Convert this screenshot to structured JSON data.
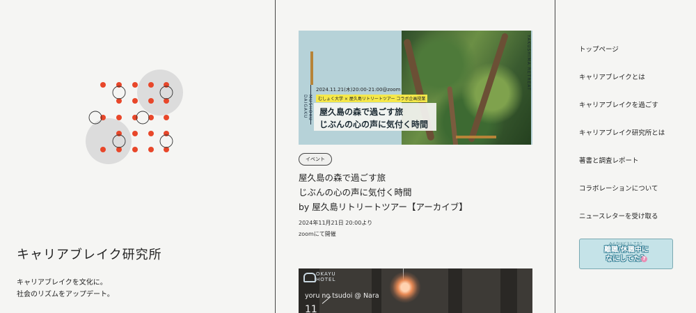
{
  "site": {
    "title": "キャリアブレイク研究所",
    "tagline_line1": "キャリアブレイクを文化に。",
    "tagline_line2": "社会のリズムをアップデート。"
  },
  "colors": {
    "accent": "#e8472a",
    "circle_fill": "#dcdcdc",
    "background": "#f5f5f3"
  },
  "card1": {
    "image": {
      "date": "2024.11.21(木)20:00-21:00@zoom",
      "collab": "むしょく大学 × 屋久島リトリートツアー コラボ企画授業",
      "title_line1": "屋久島の森で過ごす旅",
      "title_line2": "じぶんの心の声に気付く時間",
      "vertical_left": "MUSHOKU DAIGAKU",
      "vertical_right": "YAKUSHIMA RETREAT"
    },
    "badge": "イベント",
    "title_line1": "屋久島の森で過ごす旅",
    "title_line2": "じぶんの心の声に気付く時間",
    "title_line3": "by 屋久島リトリートツアー【アーカイブ】",
    "meta_line1": "2024年11月21日 20:00より",
    "meta_line2": "zoomにて開催"
  },
  "card2": {
    "image": {
      "logo_line1": "OKAYU",
      "logo_line2": "HOTEL",
      "title": "yoru no tsudoi @ Nara",
      "number": "11"
    }
  },
  "nav": {
    "items": [
      {
        "label": "トップページ"
      },
      {
        "label": "キャリアブレイクとは"
      },
      {
        "label": "キャリアブレイクを過ごす"
      },
      {
        "label": "キャリアブレイク研究所とは"
      },
      {
        "label": "著書と調査レポート"
      },
      {
        "label": "コラボレーションについて"
      },
      {
        "label": "ニュースレターを受け取る"
      }
    ]
  },
  "banner": {
    "small": "みんなはどうしてた？",
    "line1": "離職/休職中に",
    "line2": "なにしてた？",
    "q": "?"
  }
}
